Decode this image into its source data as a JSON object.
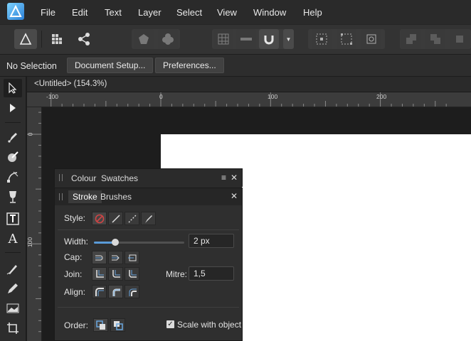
{
  "menubar": {
    "items": [
      "File",
      "Edit",
      "Text",
      "Layer",
      "Select",
      "View",
      "Window",
      "Help"
    ]
  },
  "context": {
    "selection_label": "No Selection",
    "document_setup": "Document Setup...",
    "preferences": "Preferences..."
  },
  "document": {
    "tab_title": "<Untitled> (154.3%)"
  },
  "rulers": {
    "unit": "px",
    "h_labels": [
      "-100",
      "0",
      "100",
      "200"
    ],
    "v_labels": [
      "0",
      "100"
    ]
  },
  "colour_panel": {
    "tabs": [
      "Colour",
      "Swatches"
    ]
  },
  "stroke_panel": {
    "tabs": [
      "Stroke",
      "Brushes"
    ],
    "style_label": "Style:",
    "width_label": "Width:",
    "width_value": "2 px",
    "width_fraction": 0.24,
    "cap_label": "Cap:",
    "join_label": "Join:",
    "mitre_label": "Mitre:",
    "mitre_value": "1,5",
    "align_label": "Align:",
    "order_label": "Order:",
    "scale_label": "Scale with object",
    "scale_checked": true
  },
  "colors": {
    "accent": "#5a9bd8",
    "no_style_red": "#d04545"
  }
}
